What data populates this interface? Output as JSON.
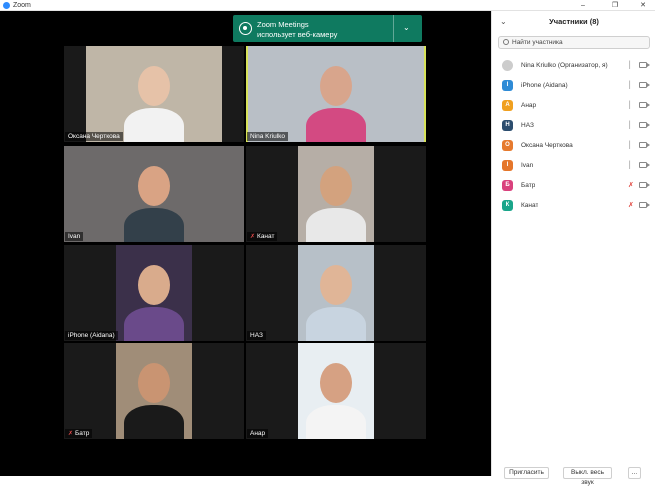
{
  "window": {
    "title": "Zoom",
    "controls": [
      "–",
      "❐",
      "✕"
    ]
  },
  "notification": {
    "line1": "Zoom Meetings",
    "line2": "использует веб-камеру",
    "chevron": "⌄"
  },
  "tiles": [
    {
      "name": "Оксана Черткова",
      "muted": false,
      "active": false,
      "bg": "#bfb6a7",
      "skin": "#e6c2a8",
      "shirt": "#f2f2f2"
    },
    {
      "name": "Nina Kriulko",
      "muted": false,
      "active": true,
      "bg": "#b9bfc6",
      "skin": "#d8a58c",
      "shirt": "#d34a82"
    },
    {
      "name": "Ivan",
      "muted": false,
      "active": false,
      "bg": "#6d6a6a",
      "skin": "#d9a384",
      "shirt": "#33404a"
    },
    {
      "name": "Канат",
      "muted": true,
      "active": false,
      "bg": "#b6aea6",
      "skin": "#d3a27e",
      "shirt": "#e8e8e8"
    },
    {
      "name": "iPhone (Aidana)",
      "muted": false,
      "active": false,
      "bg": "#3b304a",
      "skin": "#d9ab8c",
      "shirt": "#6a4a8a"
    },
    {
      "name": "НАЗ",
      "muted": false,
      "active": false,
      "bg": "#b7c0c8",
      "skin": "#e0b597",
      "shirt": "#c8d4e0"
    },
    {
      "name": "Батр",
      "muted": true,
      "active": false,
      "bg": "#a08d78",
      "skin": "#c99472",
      "shirt": "#1a1a1a"
    },
    {
      "name": "Анар",
      "muted": false,
      "active": false,
      "bg": "#e8eef2",
      "skin": "#d6a183",
      "shirt": "#f4f4f4"
    }
  ],
  "panel": {
    "title": "Участники (8)",
    "search_placeholder": "Найти участника",
    "participants": [
      {
        "name": "Nina Kriulko (Организатор, я)",
        "initial": "",
        "color": "#cccccc",
        "muted": false
      },
      {
        "name": "iPhone (Aidana)",
        "initial": "I",
        "color": "#2e8bd6",
        "muted": false
      },
      {
        "name": "Анар",
        "initial": "А",
        "color": "#f0a020",
        "muted": false
      },
      {
        "name": "НАЗ",
        "initial": "Н",
        "color": "#2c4d6e",
        "muted": false
      },
      {
        "name": "Оксана Черткова",
        "initial": "О",
        "color": "#e67a2e",
        "muted": false
      },
      {
        "name": "Ivan",
        "initial": "I",
        "color": "#e5762a",
        "muted": false
      },
      {
        "name": "Батр",
        "initial": "Б",
        "color": "#d9417d",
        "muted": true
      },
      {
        "name": "Канат",
        "initial": "К",
        "color": "#1aa58a",
        "muted": true
      }
    ],
    "invite_label": "Пригласить",
    "mute_all_label": "Выкл. весь звук",
    "more_label": "..."
  }
}
